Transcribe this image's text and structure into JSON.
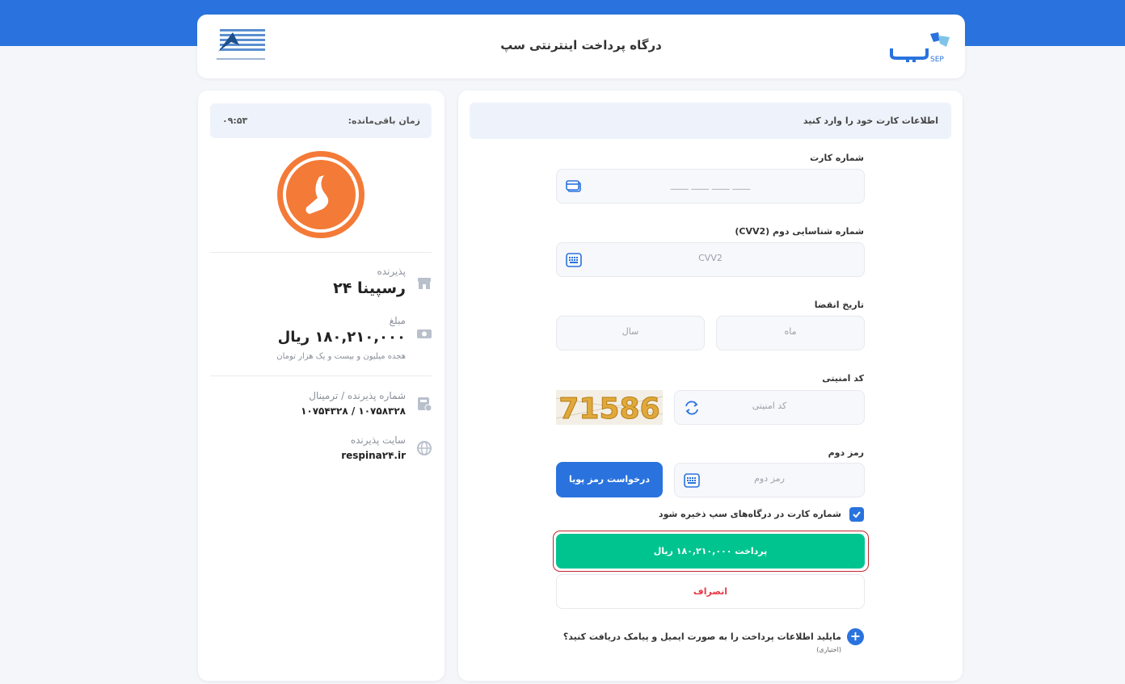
{
  "header": {
    "title": "درگاه پرداخت اینترنتی سپ",
    "sep_logo_text": "SEP"
  },
  "sidebar": {
    "timer_label": "زمان باقی‌مانده:",
    "timer_value": "۰۹:۵۳",
    "merchant_label": "پذیرنده",
    "merchant_name": "رسپینا ۲۴",
    "amount_label": "مبلغ",
    "amount_value": "۱۸۰,۲۱۰,۰۰۰ ریال",
    "amount_words": "هجده میلیون و بیست و یک هزار تومان",
    "terminal_label": "شماره پذیرنده / ترمینال",
    "terminal_value": "۱۰۷۵۸۳۲۸ / ۱۰۷۵۴۳۲۸",
    "site_label": "سایت پذیرنده",
    "site_value": "respina۲۴.ir"
  },
  "form": {
    "title": "اطلاعات کارت خود را وارد کنید",
    "card_number": {
      "label": "شماره کارت",
      "placeholder": "____ ____ ____ ____"
    },
    "cvv2": {
      "label": "شماره شناسایی دوم (CVV2)",
      "placeholder": "CVV2"
    },
    "expiry": {
      "label": "تاریخ انقضا",
      "month_placeholder": "ماه",
      "year_placeholder": "سال"
    },
    "captcha": {
      "label": "کد امنیتی",
      "placeholder": "کد امنیتی",
      "image_text": "71586"
    },
    "otp": {
      "label": "رمز دوم",
      "placeholder": "رمز دوم",
      "request_button": "درخواست رمز پویا"
    },
    "save_card": {
      "checked": true,
      "label": "شماره کارت در درگاه‌های سپ ذخیره شود"
    },
    "pay_button": "پرداخت ۱۸۰,۲۱۰,۰۰۰ ریال",
    "cancel_button": "انصراف",
    "optin": {
      "text": "مایلید اطلاعات پرداخت را به صورت ایمیل و پیامک دریافت کنید؟",
      "note": "(اختیاری)"
    }
  },
  "colors": {
    "primary": "#2a73de",
    "success": "#00c48f",
    "danger": "#e53945",
    "merchant_orange": "#f47a37"
  },
  "icons": [
    "sep-logo",
    "bank-logo",
    "merchant-logo",
    "store-icon",
    "money-icon",
    "terminal-icon",
    "globe-icon",
    "credit-card-icon",
    "keypad-icon",
    "refresh-icon",
    "check-icon",
    "plus-icon"
  ]
}
